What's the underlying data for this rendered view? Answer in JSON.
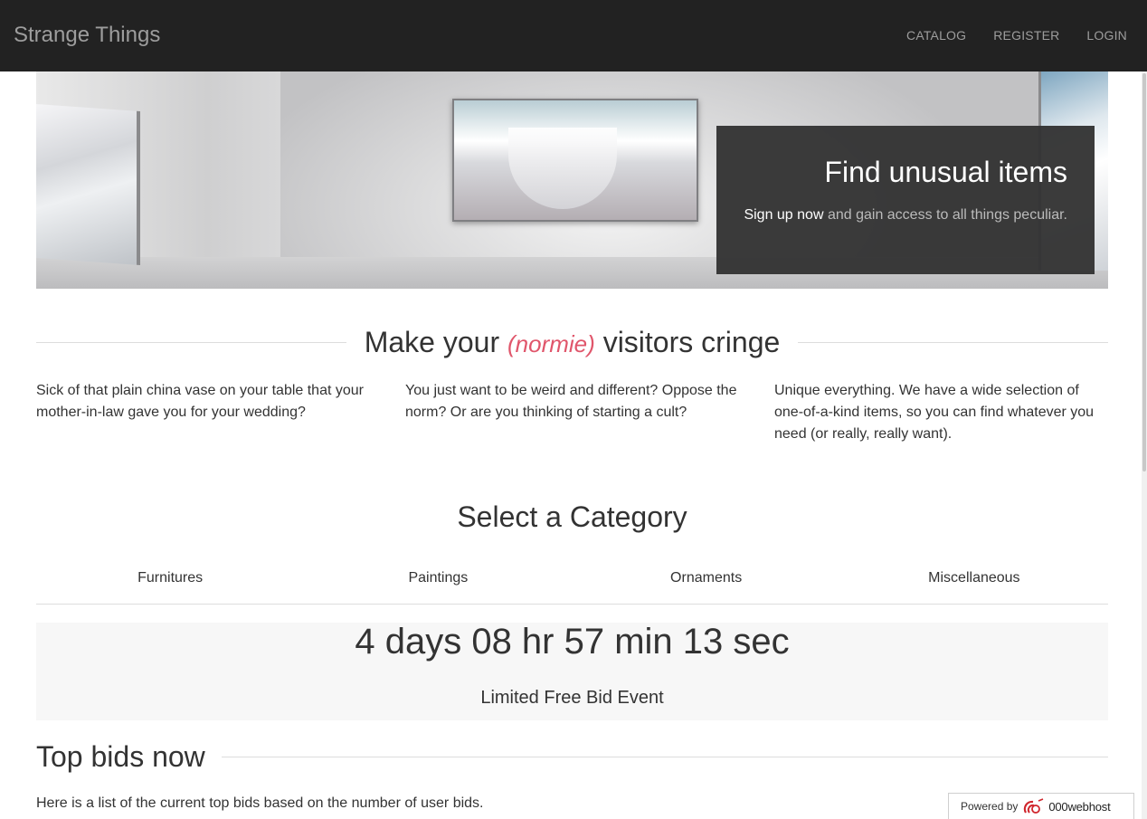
{
  "navbar": {
    "brand": "Strange Things",
    "links": [
      "CATALOG",
      "REGISTER",
      "LOGIN"
    ]
  },
  "hero": {
    "heading": "Find unusual items",
    "signup_link": "Sign up now",
    "tagline_rest": " and gain access to all things peculiar."
  },
  "intro": {
    "title_before": "Make your ",
    "title_highlight": "(normie)",
    "title_after": " visitors cringe",
    "columns": [
      "Sick of that plain china vase on your table that your mother-in-law gave you for your wedding?",
      "You just want to be weird and different? Oppose the norm? Or are you thinking of starting a cult?",
      "Unique everything. We have a wide selection of one-of-a-kind items, so you can find whatever you need (or really, really want)."
    ]
  },
  "categories": {
    "title": "Select a Category",
    "items": [
      "Furnitures",
      "Paintings",
      "Ornaments",
      "Miscellaneous"
    ]
  },
  "countdown": {
    "timer": "4 days 08 hr 57 min 13 sec",
    "event": "Limited Free Bid Event"
  },
  "top_bids": {
    "title": "Top bids now",
    "intro": "Here is a list of the current top bids based on the number of user bids."
  },
  "footer_badge": {
    "powered_by": "Powered by",
    "host": "000webhost"
  },
  "colors": {
    "navbar_bg": "#222222",
    "highlight": "#e0566b",
    "card_bg": "#333333"
  }
}
